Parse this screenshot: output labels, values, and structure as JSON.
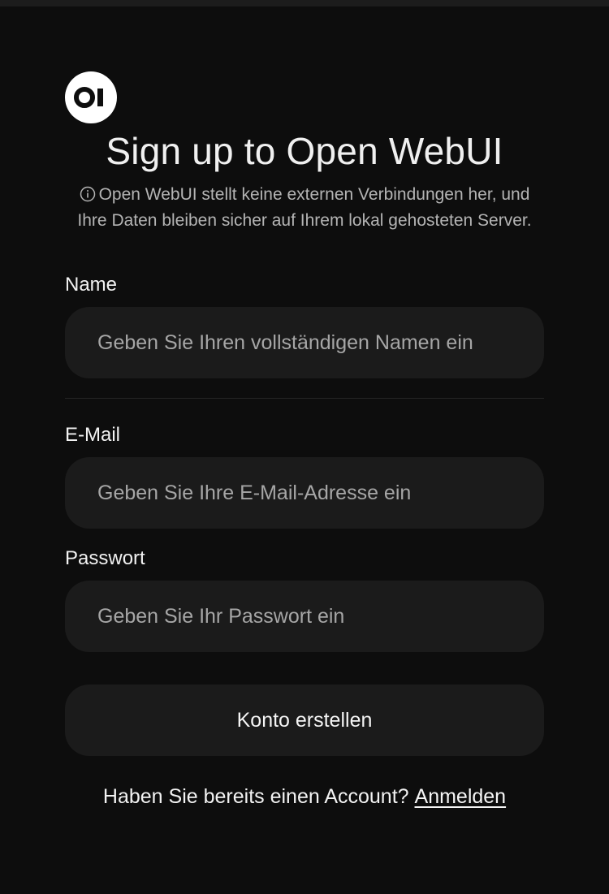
{
  "logo": {
    "icon": "open-webui-logo"
  },
  "header": {
    "title": "Sign up to Open WebUI",
    "notice": "Open WebUI stellt keine externen Verbindungen her, und Ihre Daten bleiben sicher auf Ihrem lokal gehosteten Server."
  },
  "form": {
    "name": {
      "label": "Name",
      "placeholder": "Geben Sie Ihren vollständigen Namen ein",
      "value": ""
    },
    "email": {
      "label": "E-Mail",
      "placeholder": "Geben Sie Ihre E-Mail-Adresse ein",
      "value": ""
    },
    "password": {
      "label": "Passwort",
      "placeholder": "Geben Sie Ihr Passwort ein",
      "value": ""
    },
    "submit_label": "Konto erstellen"
  },
  "footer": {
    "prompt": "Haben Sie bereits einen Account?",
    "link_label": "Anmelden"
  },
  "colors": {
    "background": "#0d0d0d",
    "input_background": "#1b1b1b",
    "text": "#ececec",
    "muted_text": "#b4b4b4"
  }
}
